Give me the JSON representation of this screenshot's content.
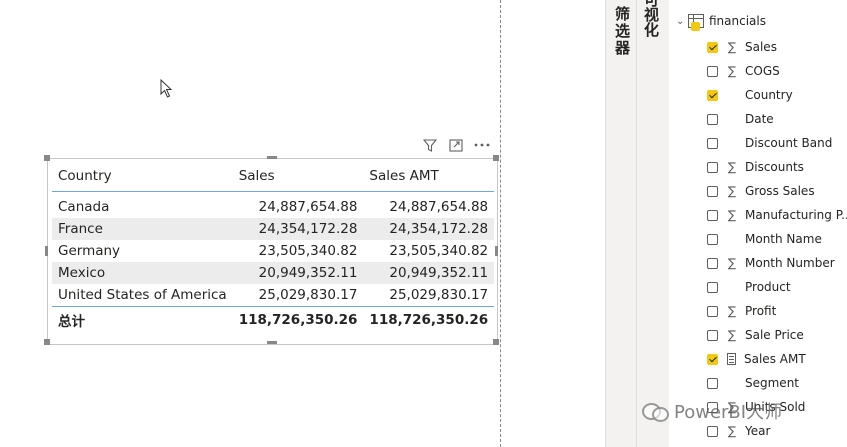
{
  "table_visual": {
    "headers": {
      "country": "Country",
      "sales": "Sales",
      "sales_amt": "Sales AMT"
    },
    "rows": [
      {
        "country": "Canada",
        "sales": "24,887,654.88",
        "sales_amt": "24,887,654.88"
      },
      {
        "country": "France",
        "sales": "24,354,172.28",
        "sales_amt": "24,354,172.28"
      },
      {
        "country": "Germany",
        "sales": "23,505,340.82",
        "sales_amt": "23,505,340.82"
      },
      {
        "country": "Mexico",
        "sales": "20,949,352.11",
        "sales_amt": "20,949,352.11"
      },
      {
        "country": "United States of America",
        "sales": "25,029,830.17",
        "sales_amt": "25,029,830.17"
      }
    ],
    "total": {
      "label": "总计",
      "sales": "118,726,350.26",
      "sales_amt": "118,726,350.26"
    },
    "header_icons": [
      "filter-icon",
      "focus-mode-icon",
      "more-options-icon"
    ]
  },
  "panes": {
    "filters_label": "筛选器",
    "visualizations_label": "可视化"
  },
  "fields_pane": {
    "table_name": "financials",
    "fields": [
      {
        "label": "Sales",
        "checked": true,
        "icon": "sigma"
      },
      {
        "label": "COGS",
        "checked": false,
        "icon": "sigma"
      },
      {
        "label": "Country",
        "checked": true,
        "icon": "none"
      },
      {
        "label": "Date",
        "checked": false,
        "icon": "none"
      },
      {
        "label": "Discount Band",
        "checked": false,
        "icon": "none"
      },
      {
        "label": "Discounts",
        "checked": false,
        "icon": "sigma"
      },
      {
        "label": "Gross Sales",
        "checked": false,
        "icon": "sigma"
      },
      {
        "label": "Manufacturing P...",
        "checked": false,
        "icon": "sigma"
      },
      {
        "label": "Month Name",
        "checked": false,
        "icon": "none"
      },
      {
        "label": "Month Number",
        "checked": false,
        "icon": "sigma"
      },
      {
        "label": "Product",
        "checked": false,
        "icon": "none"
      },
      {
        "label": "Profit",
        "checked": false,
        "icon": "sigma"
      },
      {
        "label": "Sale Price",
        "checked": false,
        "icon": "sigma"
      },
      {
        "label": "Sales AMT",
        "checked": true,
        "icon": "calculator"
      },
      {
        "label": "Segment",
        "checked": false,
        "icon": "none"
      },
      {
        "label": "Units Sold",
        "checked": false,
        "icon": "sigma"
      },
      {
        "label": "Year",
        "checked": false,
        "icon": "sigma"
      }
    ]
  },
  "watermark": {
    "text": "PowerBI大师"
  },
  "colors": {
    "accent_yellow": "#f2c811",
    "header_rule": "#6ca7e0",
    "alt_row": "#ececec"
  }
}
